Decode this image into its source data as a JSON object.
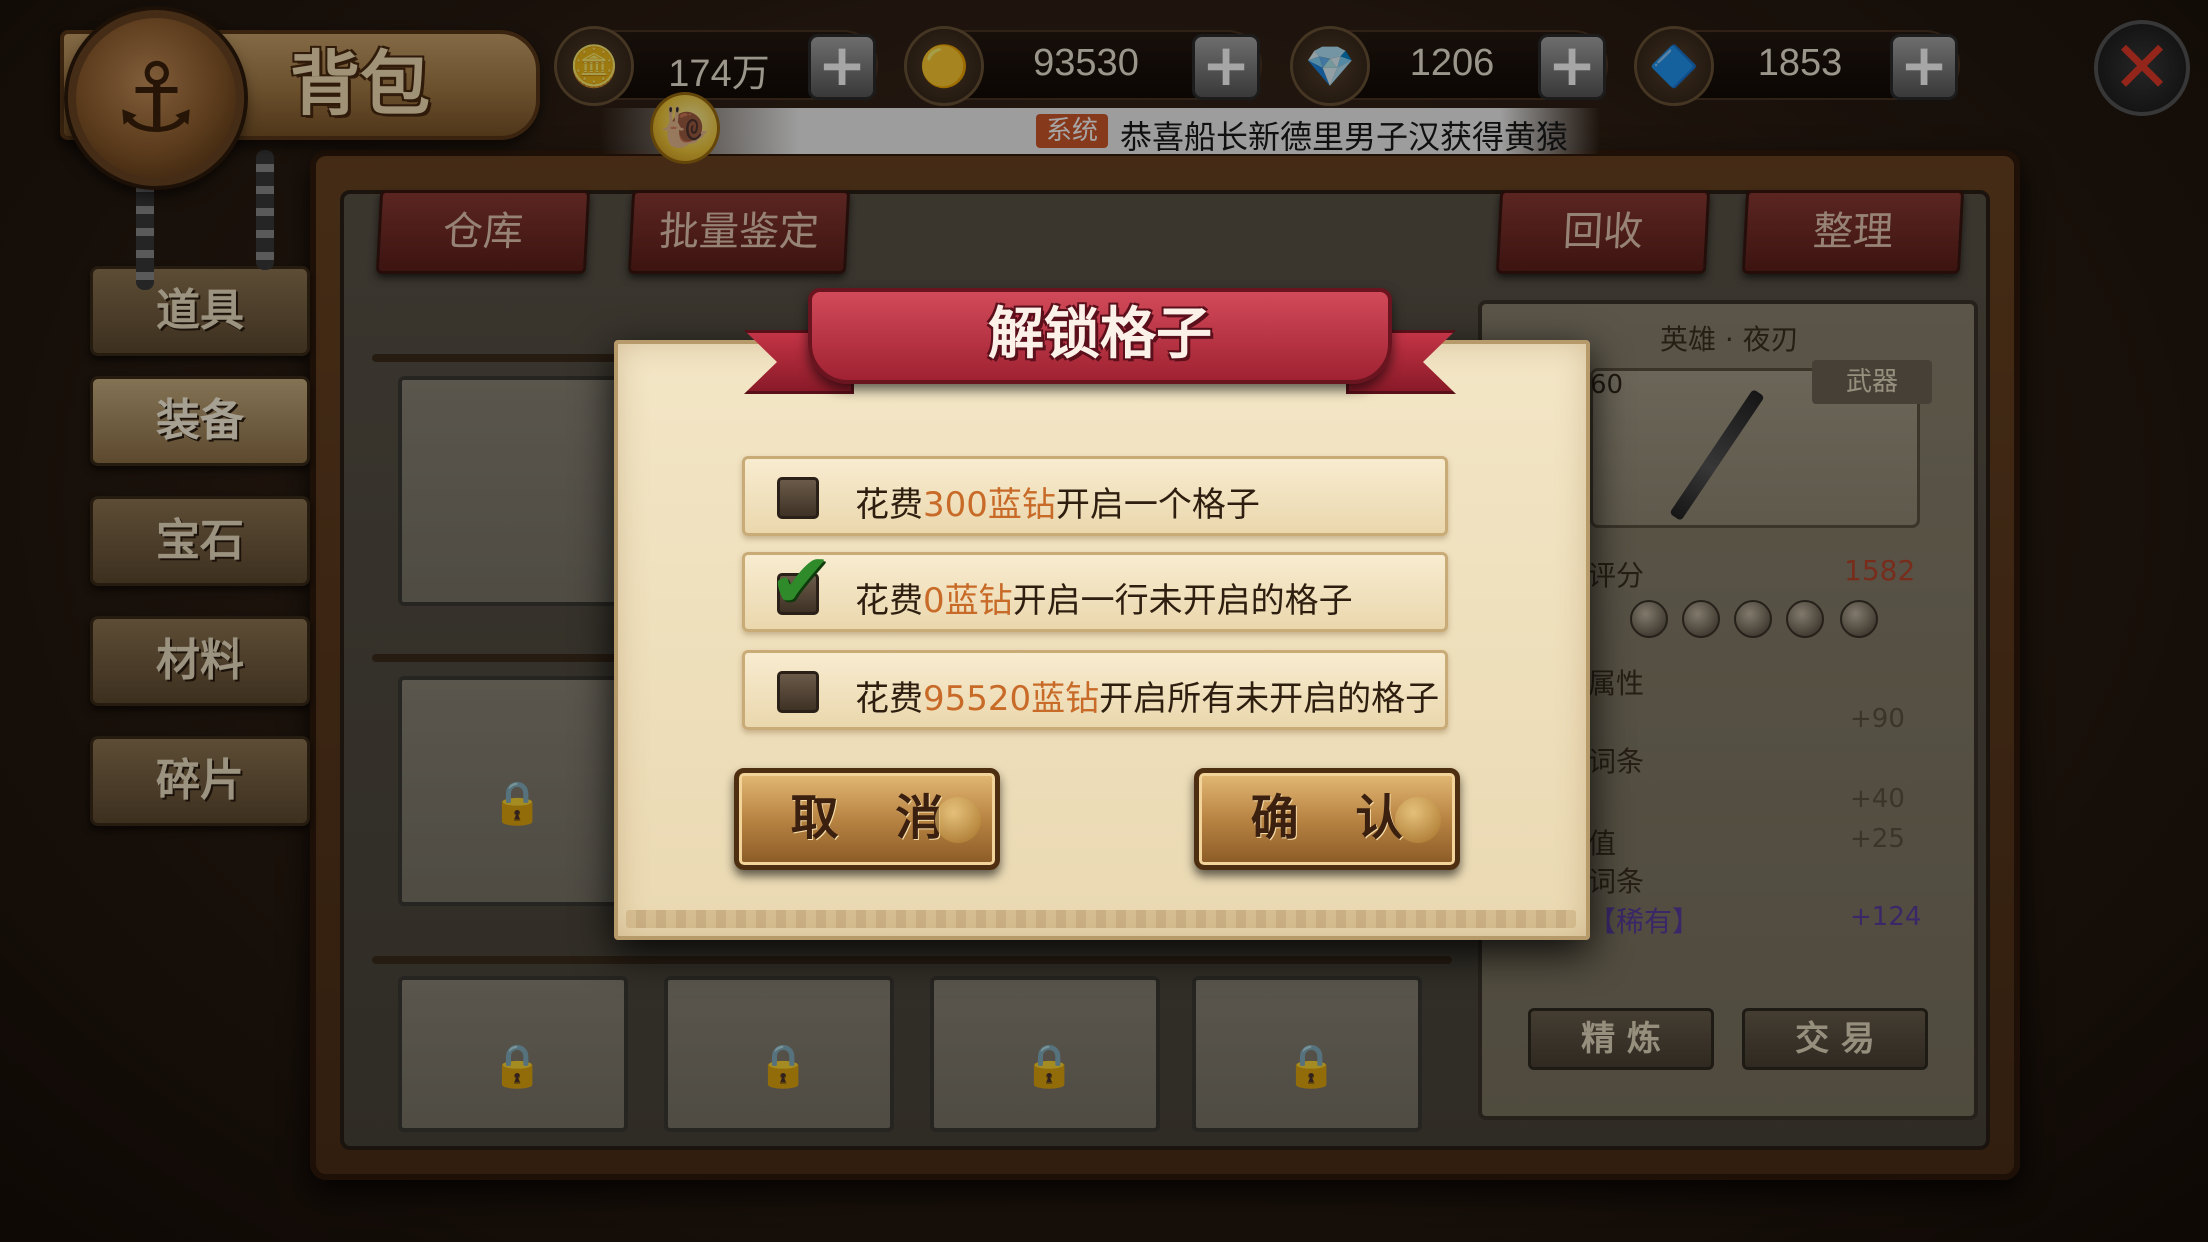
{
  "header": {
    "title": "背包",
    "emblem_icon": "anchor-icon",
    "currencies": [
      {
        "icon": "gold-ingot-icon",
        "value": "174万"
      },
      {
        "icon": "coin-icon",
        "value": "93530"
      },
      {
        "icon": "blue-diamond-icon",
        "value": "1206"
      },
      {
        "icon": "rainbow-gem-icon",
        "value": "1853"
      }
    ],
    "plus_label": "+",
    "close_label": "✕"
  },
  "notice": {
    "tag": "系统",
    "text": "恭喜船长新德里男子汉获得黄猿"
  },
  "top_tabs": {
    "warehouse": "仓库",
    "batch_appraise": "批量鉴定",
    "recycle": "回收",
    "organize": "整理"
  },
  "side_tabs": [
    "道具",
    "装备",
    "宝石",
    "材料",
    "碎片"
  ],
  "active_side_tab": "装备",
  "item_panel": {
    "name": "英雄 · 夜刃",
    "level": "60",
    "type_tag": "武器",
    "score_label": "评分",
    "score_value": "1582",
    "attributes": [
      {
        "label": "属性",
        "value": ""
      },
      {
        "label": "",
        "value": "+90"
      },
      {
        "label": "词条",
        "value": ""
      },
      {
        "label": "",
        "value": "+40"
      },
      {
        "label": "值",
        "value": "+25"
      },
      {
        "label": "词条",
        "value": ""
      },
      {
        "label": "【稀有】",
        "value": "+124"
      }
    ],
    "refine_label": "精 炼",
    "trade_label": "交 易"
  },
  "modal": {
    "title": "解锁格子",
    "options": [
      {
        "prefix": "花费",
        "amount": "300蓝钻",
        "suffix": "开启一个格子",
        "checked": false
      },
      {
        "prefix": "花费",
        "amount": "0蓝钻",
        "suffix": "开启一行未开启的格子",
        "checked": true
      },
      {
        "prefix": "花费",
        "amount": "95520蓝钻",
        "suffix": "开启所有未开启的格子",
        "checked": false
      }
    ],
    "cancel_label": "取 消",
    "confirm_label": "确 认"
  },
  "colors": {
    "highlight": "#c86a28",
    "ribbon": "#b02a3a",
    "score": "#b9452c",
    "rare": "#5a3ca0"
  }
}
